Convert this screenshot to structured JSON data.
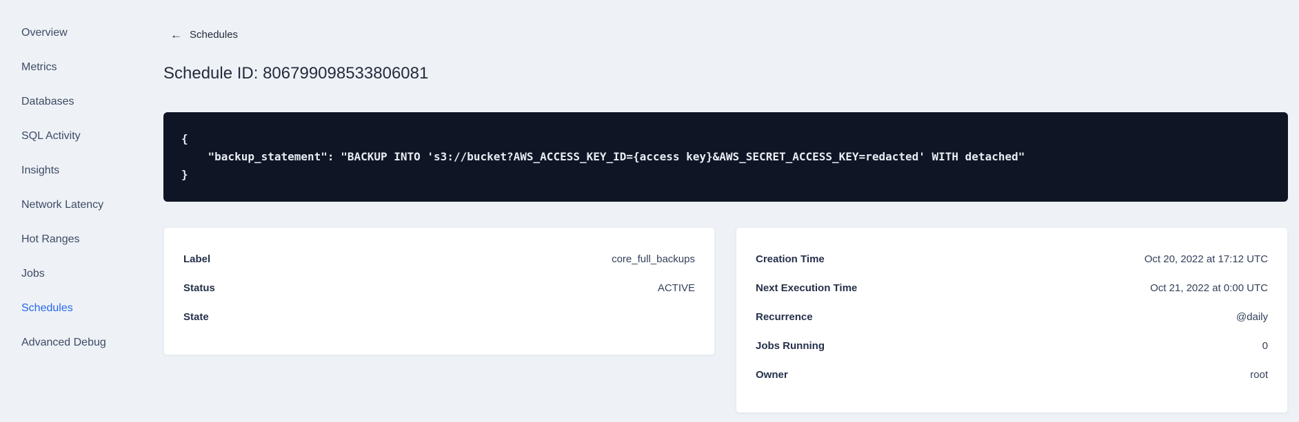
{
  "sidebar": {
    "active_item": "Schedules",
    "active_color": "#2567ee",
    "items": [
      {
        "label": "Overview"
      },
      {
        "label": "Metrics"
      },
      {
        "label": "Databases"
      },
      {
        "label": "SQL Activity"
      },
      {
        "label": "Insights"
      },
      {
        "label": "Network Latency"
      },
      {
        "label": "Hot Ranges"
      },
      {
        "label": "Jobs"
      },
      {
        "label": "Schedules"
      },
      {
        "label": "Advanced Debug"
      }
    ]
  },
  "header": {
    "back_icon": "←",
    "back_label": "Schedules",
    "title": "Schedule ID: 806799098533806081"
  },
  "code_block": {
    "background": "#0f1524",
    "text_color": "#e8ecf4",
    "lines": [
      "{",
      "    \"backup_statement\": \"BACKUP INTO 's3://bucket?AWS_ACCESS_KEY_ID={access key}&AWS_SECRET_ACCESS_KEY=redacted' WITH detached\"",
      "}"
    ]
  },
  "schedule_card": {
    "rows": [
      {
        "label": "Label",
        "value": "core_full_backups"
      },
      {
        "label": "Status",
        "value": "ACTIVE"
      },
      {
        "label": "State",
        "value": ""
      }
    ]
  },
  "timing_card": {
    "rows": [
      {
        "label": "Creation Time",
        "value": "Oct 20, 2022 at 17:12 UTC"
      },
      {
        "label": "Next Execution Time",
        "value": "Oct 21, 2022 at 0:00 UTC"
      },
      {
        "label": "Recurrence",
        "value": "@daily"
      },
      {
        "label": "Jobs Running",
        "value": "0"
      },
      {
        "label": "Owner",
        "value": "root"
      }
    ]
  }
}
